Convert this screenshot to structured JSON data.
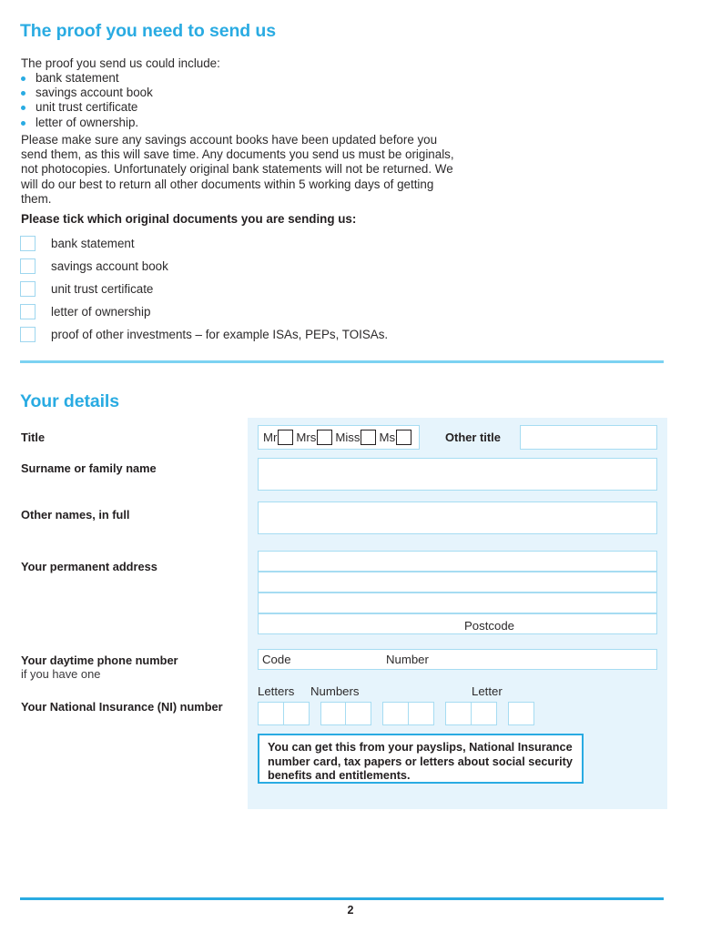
{
  "proof_section": {
    "heading": "The proof you need to send us",
    "intro": "The proof you send us could include:",
    "bullets": [
      "bank statement",
      "savings account book",
      "unit trust certificate",
      "letter of ownership."
    ],
    "paragraph": "Please make sure any savings account books have been updated before you send them, as this will save time. Any documents you send us must be originals, not photocopies. Unfortunately original bank statements will not be returned. We will do our best to return all other documents within 5 working days of getting them.",
    "tick_instruction": "Please tick which original documents you are sending us:",
    "checkboxes": [
      "bank statement",
      "savings account book",
      "unit trust certificate",
      "letter of ownership",
      "proof of other investments – for example ISAs, PEPs, TOISAs."
    ]
  },
  "details_section": {
    "heading": "Your details",
    "labels": {
      "title": "Title",
      "surname": "Surname or family name",
      "other_names": "Other names, in full",
      "address": "Your permanent address",
      "phone": "Your daytime phone number",
      "phone_sub": "if you have one",
      "ni": "Your National Insurance (NI) number"
    },
    "title_options": [
      "Mr",
      "Mrs",
      "Miss",
      "Ms"
    ],
    "other_title_label": "Other title",
    "other_title_value": "",
    "surname_value": "",
    "other_names_value": "",
    "address_lines": [
      "",
      "",
      "",
      ""
    ],
    "postcode_label": "Postcode",
    "phone": {
      "code_label": "Code",
      "number_label": "Number",
      "code_value": "",
      "number_value": ""
    },
    "ni": {
      "column_labels": {
        "letters": "Letters",
        "numbers": "Numbers",
        "letter": "Letter"
      },
      "info_text": "You can get this from your payslips, National Insurance number card, tax papers or letters about social security benefits and entitlements."
    }
  },
  "footer": {
    "page_number": "2"
  },
  "colors": {
    "heading_blue": "#29abe2",
    "panel_blue": "#e6f4fc",
    "field_border": "#a6dcf2",
    "divider": "#7cd2f2",
    "text": "#231f20"
  }
}
